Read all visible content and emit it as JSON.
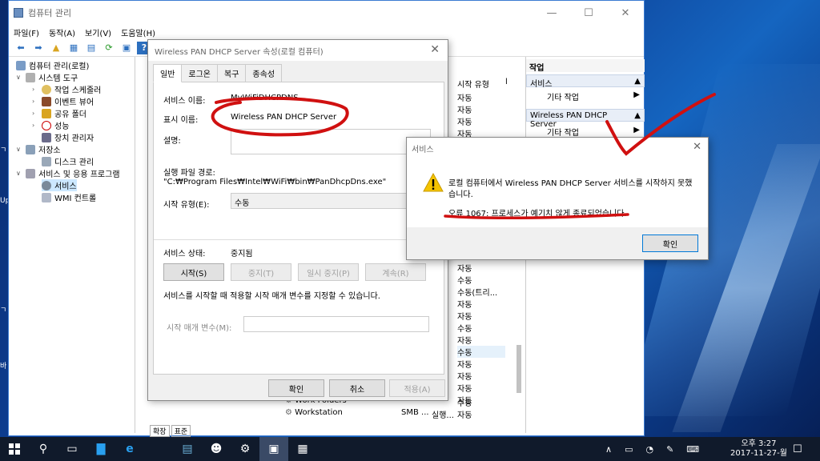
{
  "desktop": {
    "left_labels": [
      "Upc",
      "ㄱ",
      "바",
      "ㄱ"
    ]
  },
  "main_window": {
    "title": "컴퓨터 관리",
    "menu": [
      "파일(F)",
      "동작(A)",
      "보기(V)",
      "도움말(H)"
    ],
    "tree": [
      {
        "label": "컴퓨터 관리(로컬)",
        "level": 0
      },
      {
        "label": "시스템 도구",
        "level": 1
      },
      {
        "label": "작업 스케줄러",
        "level": 2
      },
      {
        "label": "이벤트 뷰어",
        "level": 2
      },
      {
        "label": "공유 폴더",
        "level": 2
      },
      {
        "label": "성능",
        "level": 2
      },
      {
        "label": "장치 관리자",
        "level": 2
      },
      {
        "label": "저장소",
        "level": 1
      },
      {
        "label": "디스크 관리",
        "level": 2
      },
      {
        "label": "서비스 및 응용 프로그램",
        "level": 1
      },
      {
        "label": "서비스",
        "level": 2
      },
      {
        "label": "WMI 컨트롤",
        "level": 2
      }
    ],
    "list": {
      "col_startup": "시작 유형",
      "startup_values": [
        "자동",
        "자동",
        "자동",
        "자동"
      ],
      "startup_values_lower": [
        "자동",
        "수동",
        "수동(트리...",
        "자동",
        "자동",
        "수동",
        "자동",
        "수동",
        "자동",
        "자동",
        "자동",
        "자동",
        "자동"
      ],
      "bottom_rows": [
        {
          "name": "Work Folders",
          "desc": "",
          "status": "",
          "startup": "수동"
        },
        {
          "name": "Workstation",
          "desc": "SMB ...",
          "status": "실행...",
          "startup": "자동"
        }
      ],
      "tabs": [
        "확장",
        "표준"
      ]
    },
    "actions": {
      "header": "작업",
      "group1": "서비스",
      "group1_item": "기타 작업",
      "group2": "Wireless PAN DHCP Server",
      "group2_item": "기타 작업"
    }
  },
  "properties_dialog": {
    "title": "Wireless PAN DHCP Server 속성(로컬 컴퓨터)",
    "tabs": [
      "일반",
      "로그온",
      "복구",
      "종속성"
    ],
    "service_name_label": "서비스 이름:",
    "service_name": "MyWiFiDHCPDNS",
    "display_name_label": "표시 이름:",
    "display_name": "Wireless PAN DHCP Server",
    "description_label": "설명:",
    "exe_path_label": "실행 파일 경로:",
    "exe_path": "\"C:₩Program Files₩Intel₩WiFi₩bin₩PanDhcpDns.exe\"",
    "startup_type_label": "시작 유형(E):",
    "startup_type": "수동",
    "status_label": "서비스 상태:",
    "status": "중지됨",
    "start_btn": "시작(S)",
    "stop_btn": "중지(T)",
    "pause_btn": "일시 중지(P)",
    "resume_btn": "계속(R)",
    "hint": "서비스를 시작할 때 적용할 시작 매개 변수를 지정할 수 있습니다.",
    "param_label": "시작 매개 변수(M):",
    "ok": "확인",
    "cancel": "취소",
    "apply": "적용(A)"
  },
  "message_box": {
    "title": "서비스",
    "line1": "로컬 컴퓨터에서 Wireless PAN DHCP Server 서비스를 시작하지 못했",
    "line2": "습니다.",
    "error": "오류 1067: 프로세스가 예기치 않게 종료되었습니다.",
    "ok": "확인"
  },
  "taskbar": {
    "time": "오후 3:27",
    "date": "2017-11-27-월"
  },
  "colors": {
    "accent": "#0078d7",
    "annotation": "#d01010",
    "taskbar": "#101a2b"
  }
}
